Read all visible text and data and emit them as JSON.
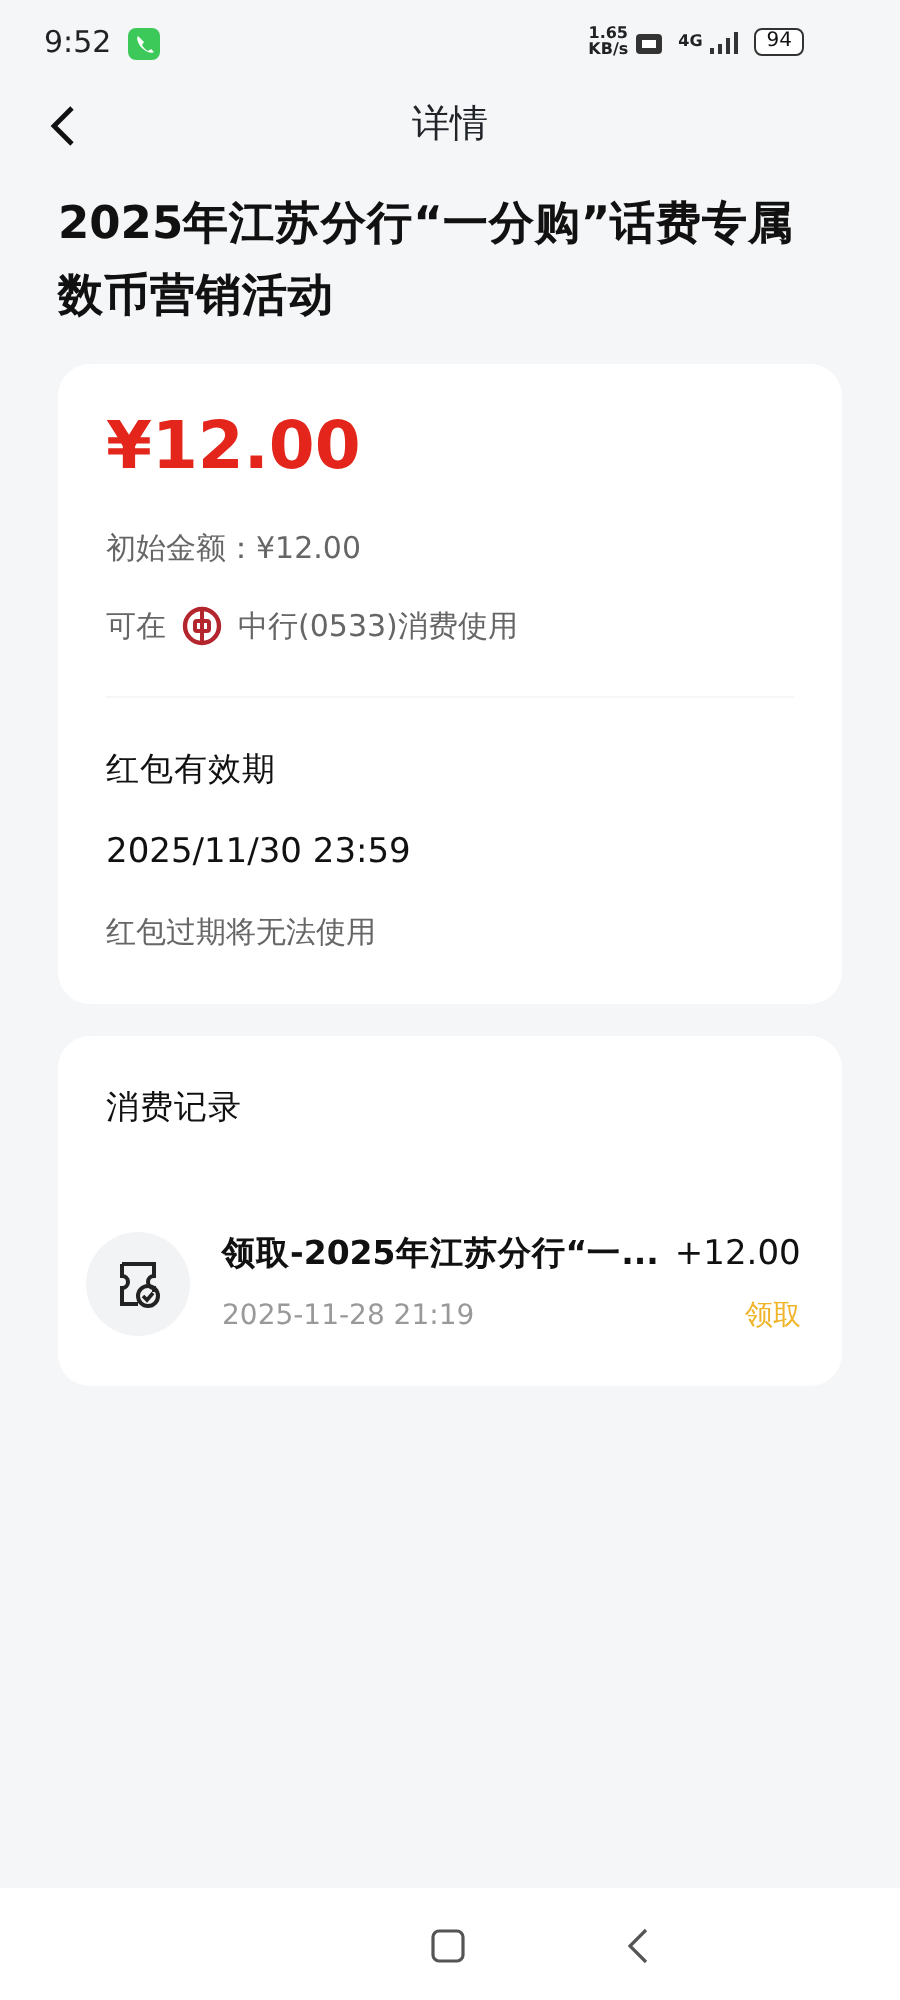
{
  "status_bar": {
    "time": "9:52",
    "speed": "1.65",
    "speed_unit": "KB/s",
    "network": "4G",
    "battery": "94"
  },
  "header": {
    "title": "详情"
  },
  "headline": "2025年江苏分行“一分购”话费专属数币营销活动",
  "balance_card": {
    "amount": "¥12.00",
    "initial": "初始金额：¥12.00",
    "usage_prefix": "可在",
    "usage_text": "中行(0533)消费使用",
    "validity_label": "红包有效期",
    "validity_date": "2025/11/30 23:59",
    "validity_note": "红包过期将无法使用"
  },
  "records": {
    "title": "消费记录",
    "items": [
      {
        "name": "领取-2025年江苏分行“一...",
        "amount": "+12.00",
        "time": "2025-11-28 21:19",
        "status": "领取"
      }
    ]
  }
}
